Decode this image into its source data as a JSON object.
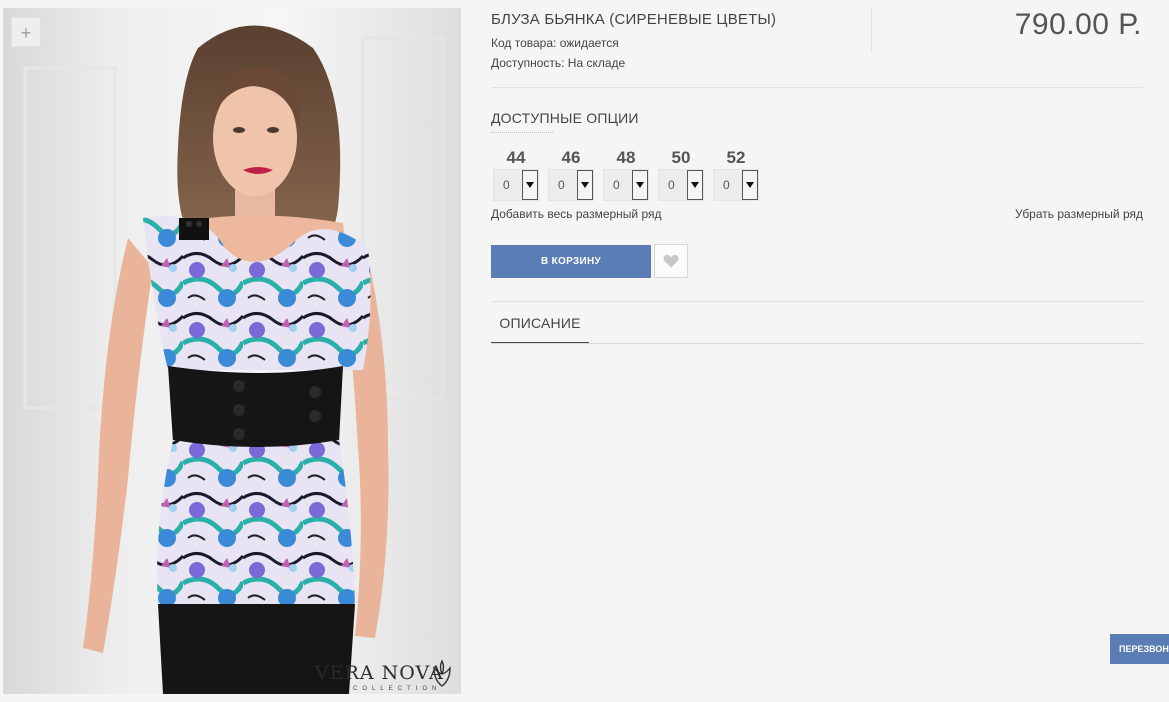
{
  "product": {
    "title": "БЛУЗА БЬЯНКА (СИРЕНЕВЫЕ ЦВЕТЫ)",
    "code_line": "Код товара: ожидается",
    "availability_line": "Доступность: На складе",
    "price": "790.00 Р."
  },
  "gallery": {
    "zoom_label": "+",
    "image_alt": "model in floral blouse",
    "brand_name": "VERA NOVA",
    "brand_sub": "COLLECTION"
  },
  "options": {
    "title": "ДОСТУПНЫЕ ОПЦИИ",
    "sizes": [
      {
        "label": "44",
        "value": "0"
      },
      {
        "label": "46",
        "value": "0"
      },
      {
        "label": "48",
        "value": "0"
      },
      {
        "label": "50",
        "value": "0"
      },
      {
        "label": "52",
        "value": "0"
      }
    ],
    "add_row_label": "Добавить весь размерный ряд",
    "remove_row_label": "Убрать размерный ряд"
  },
  "actions": {
    "cart_label": "В КОРЗИНУ",
    "wishlist_icon": "heart-icon"
  },
  "tabs": [
    {
      "label": "ОПИСАНИЕ",
      "active": true
    }
  ],
  "callback": {
    "label": "ПЕРЕЗВОН"
  },
  "colors": {
    "accent": "#5a7db6",
    "background": "#f5f5f5",
    "text": "#444444"
  }
}
